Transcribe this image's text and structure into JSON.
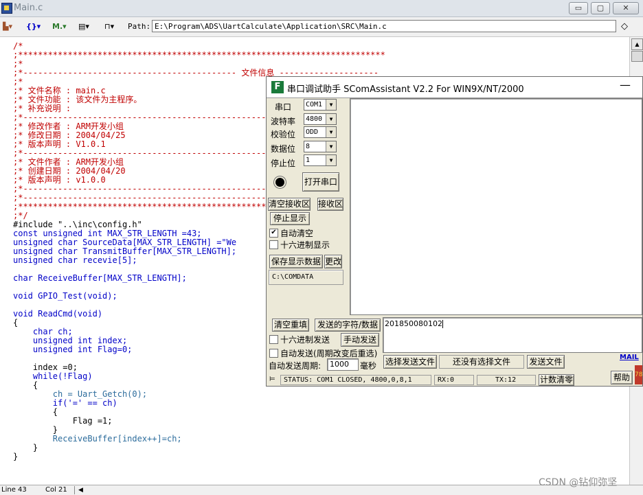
{
  "editor": {
    "title": "Main.c",
    "window_buttons": {
      "minimize": "▭",
      "maximize": "▢",
      "close": "✕"
    },
    "path_label": "Path:",
    "path_value": "E:\\Program\\ADS\\UartCalculate\\Application\\SRC\\Main.c",
    "status": {
      "line": "Line 43",
      "col": "Col 21"
    }
  },
  "code_lines": [
    "/*",
    ";**************************************************************************",
    ";*",
    ";*------------------------------------------- 文件信息 --------------------",
    ";*",
    ";* 文件名称 : main.c",
    ";* 文件功能 : 该文件为主程序。",
    ";* 补充说明 :",
    ";*---------------------------------------------------------------------",
    ";* 修改作者 : ARM开发小组",
    ";* 修改日期 : 2004/04/25",
    ";* 版本声明 : V1.0.1",
    ";*---------------------------------------------------------------------",
    ";* 文件作者 : ARM开发小组",
    ";* 创建日期 : 2004/04/20",
    ";* 版本声明 : v1.0.0",
    ";*---------------------------------------------------------------------",
    ";*---------------------------------------------------------------------",
    ";**************************************************************************",
    ";*/",
    "#include \"..\\inc\\config.h\"",
    "const unsigned int MAX_STR_LENGTH =43;",
    "unsigned char SourceData[MAX_STR_LENGTH] =\"We",
    "unsigned char TransmitBuffer[MAX_STR_LENGTH];",
    "unsigned char recevie[5];",
    "",
    "char ReceiveBuffer[MAX_STR_LENGTH];",
    "",
    "void GPIO_Test(void);",
    "",
    "void ReadCmd(void)",
    "{",
    "    char ch;",
    "    unsigned int index;",
    "    unsigned int Flag=0;",
    "",
    "    index =0;",
    "    while(!Flag)",
    "    {",
    "        ch = Uart_Getch(0);",
    "        if('=' == ch)",
    "        {",
    "            Flag =1;",
    "        }",
    "        ReceiveBuffer[index++]=ch;",
    "    }",
    "}"
  ],
  "serial_assistant": {
    "title": "串口调试助手 SComAssistant V2.2 For WIN9X/NT/2000",
    "minimize": "—",
    "settings": [
      {
        "label": "串口",
        "value": "COM1"
      },
      {
        "label": "波特率",
        "value": "4800"
      },
      {
        "label": "校验位",
        "value": "ODD"
      },
      {
        "label": "数据位",
        "value": "8"
      },
      {
        "label": "停止位",
        "value": "1"
      }
    ],
    "open_port_button": "打开串口",
    "clear_receive_button": "清空接收区",
    "receive_area_label": "接收区",
    "stop_display_button": "停止显示",
    "auto_clear_label": "自动清空",
    "auto_clear_checked": true,
    "hex_display_label": "十六进制显示",
    "save_data_button": "保存显示数据",
    "change_button": "更改",
    "save_path": "C:\\COMDATA",
    "clear_send_button": "清空重填",
    "send_chars_label": "发送的字符/数据",
    "send_text": "201850080102",
    "hex_send_label": "十六进制发送",
    "manual_send_button": "手动发送",
    "auto_send_label": "自动发送(周期改变后重选)",
    "auto_period_label": "自动发送周期:",
    "auto_period_value": "1000",
    "ms_label": "毫秒",
    "select_file_button": "选择发送文件",
    "no_file_label": "还没有选择文件",
    "send_file_button": "发送文件",
    "mail_link": "MAIL",
    "help_button": "帮助",
    "status_text": "STATUS: COM1 CLOSED, 4800,0,8,1",
    "rx_text": "RX:0",
    "tx_text": "TX:12",
    "reset_count_button": "计数清零"
  },
  "watermark": "CSDN @钻仰弥坚",
  "colors": {
    "comment": "#c00000",
    "keyword": "#0000c8",
    "identifier": "#2c6c9c",
    "mail": "#0000c8"
  }
}
